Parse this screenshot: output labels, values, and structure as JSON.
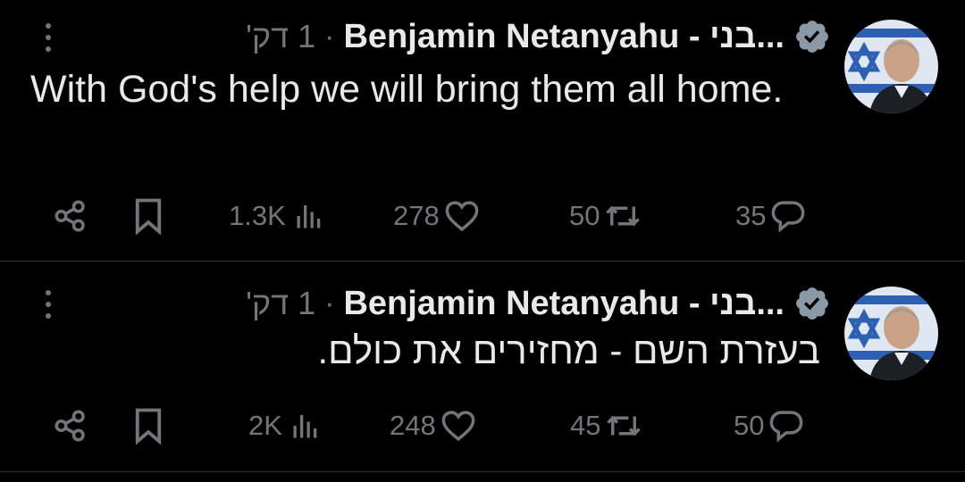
{
  "colors": {
    "background": "#000000",
    "text": "#e7e9ea",
    "muted": "#71767b",
    "verified": "#8b98a5",
    "divider": "#2f3336"
  },
  "tweets": [
    {
      "author": "Benjamin Netanyahu - בני...",
      "dot": "·",
      "time": "1 דק'",
      "text": "With God's help we will bring them all home.",
      "views": "1.3K",
      "likes": "278",
      "retweets": "50",
      "replies": "35",
      "icons": [
        "share-icon",
        "bookmark-icon",
        "views-icon",
        "heart-icon",
        "retweet-icon",
        "reply-icon",
        "more-icon",
        "verified-icon"
      ]
    },
    {
      "author": "Benjamin Netanyahu - בני...",
      "dot": "·",
      "time": "1 דק'",
      "text": "בעזרת השם - מחזירים את כולם.",
      "views": "2K",
      "likes": "248",
      "retweets": "45",
      "replies": "50",
      "icons": [
        "share-icon",
        "bookmark-icon",
        "views-icon",
        "heart-icon",
        "retweet-icon",
        "reply-icon",
        "more-icon",
        "verified-icon"
      ]
    }
  ]
}
